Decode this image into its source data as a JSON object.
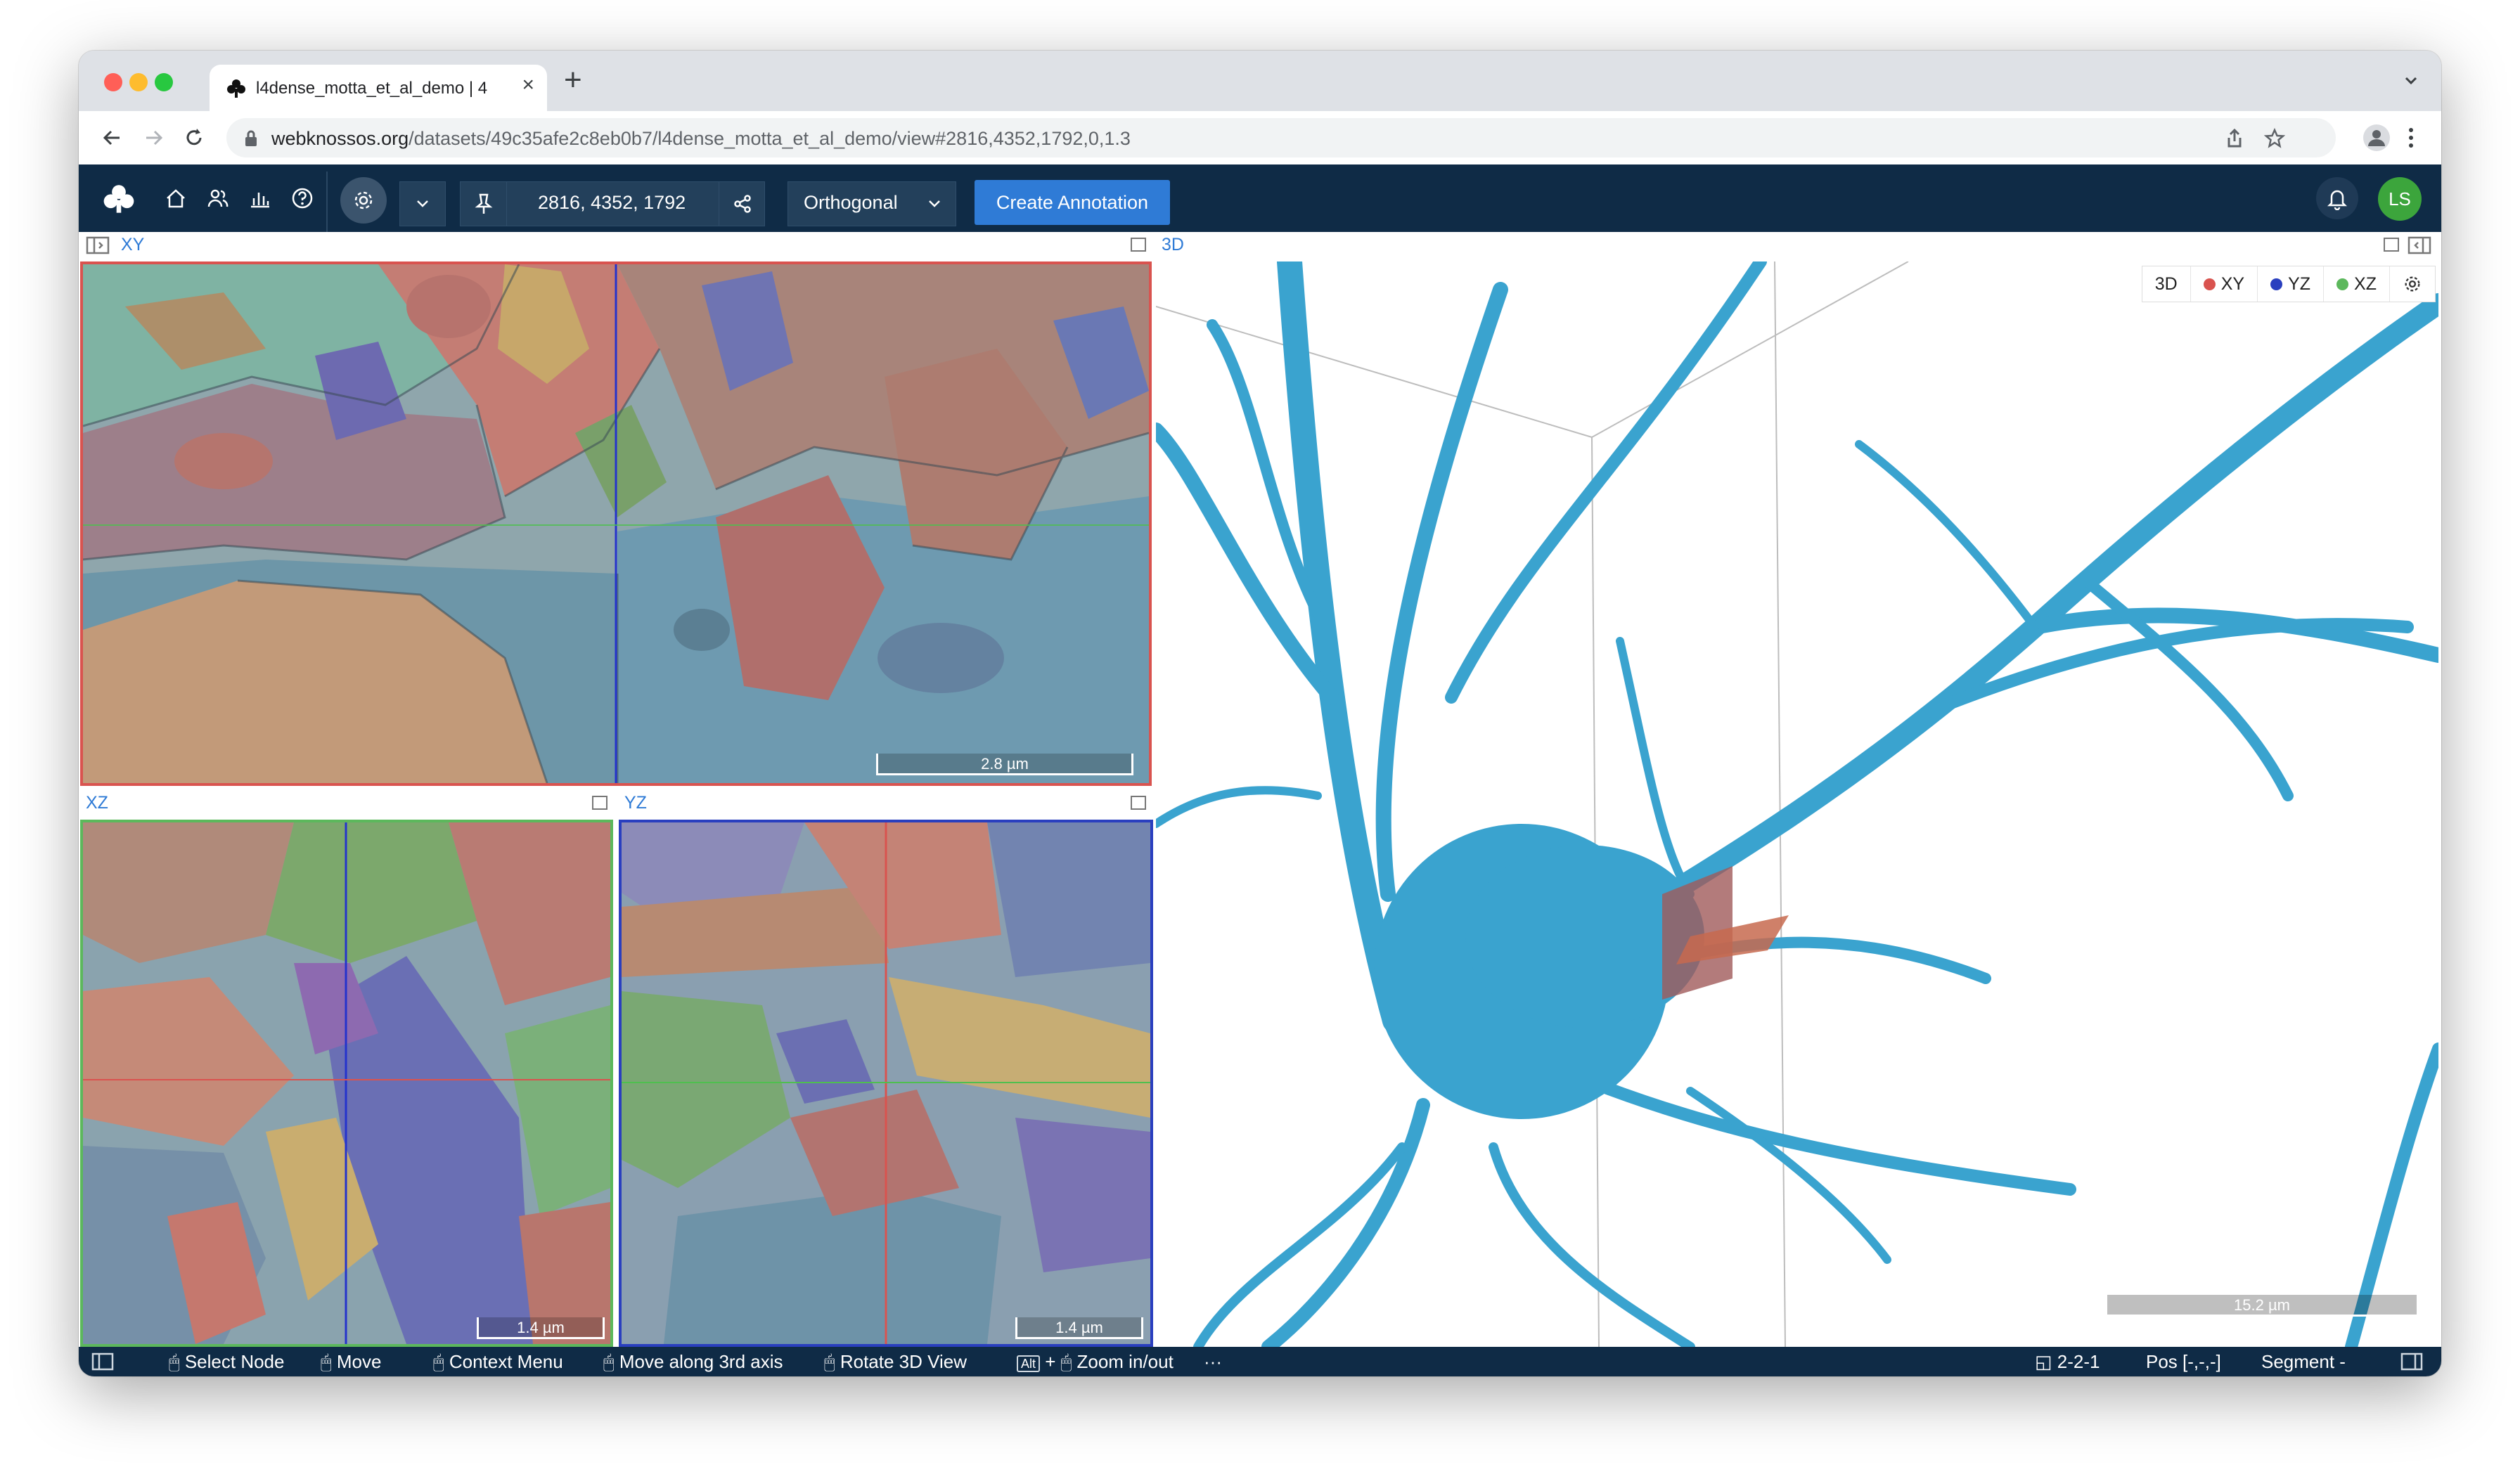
{
  "browser": {
    "tab_title": "l4dense_motta_et_al_demo | 4",
    "new_tab": "+",
    "url_domain": "webknossos.org",
    "url_path": "/datasets/49c35afe2c8eb0b7/l4dense_motta_et_al_demo/view#2816,4352,1792,0,1.3"
  },
  "toolbar": {
    "position": "2816, 4352, 1792",
    "view_mode": "Orthogonal",
    "create_annotation": "Create Annotation",
    "user_initials": "LS"
  },
  "viewports": {
    "xy_label": "XY",
    "xz_label": "XZ",
    "yz_label": "YZ",
    "td_label": "3D",
    "xy_scale": "2.8 µm",
    "xz_scale": "1.4 µm",
    "yz_scale": "1.4 µm",
    "td_scale": "15.2 µm",
    "td_buttons": [
      "3D",
      "XY",
      "YZ",
      "XZ"
    ]
  },
  "status": {
    "select_node": "Select Node",
    "move": "Move",
    "context_menu": "Context Menu",
    "move_3rd": "Move along 3rd axis",
    "rotate": "Rotate 3D View",
    "alt": "Alt",
    "plus": "+",
    "zoom": "Zoom in/out",
    "more": "···",
    "mag": "2-2-1",
    "pos": "Pos [-,-,-]",
    "segment": "Segment -"
  },
  "colors": {
    "app_bar": "#0f2b46",
    "accent": "#2f7bd6",
    "neuron": "#3aa3cf",
    "xy_border": "#d9534f",
    "xz_border": "#5cb85c",
    "yz_border": "#2a3fbf"
  }
}
